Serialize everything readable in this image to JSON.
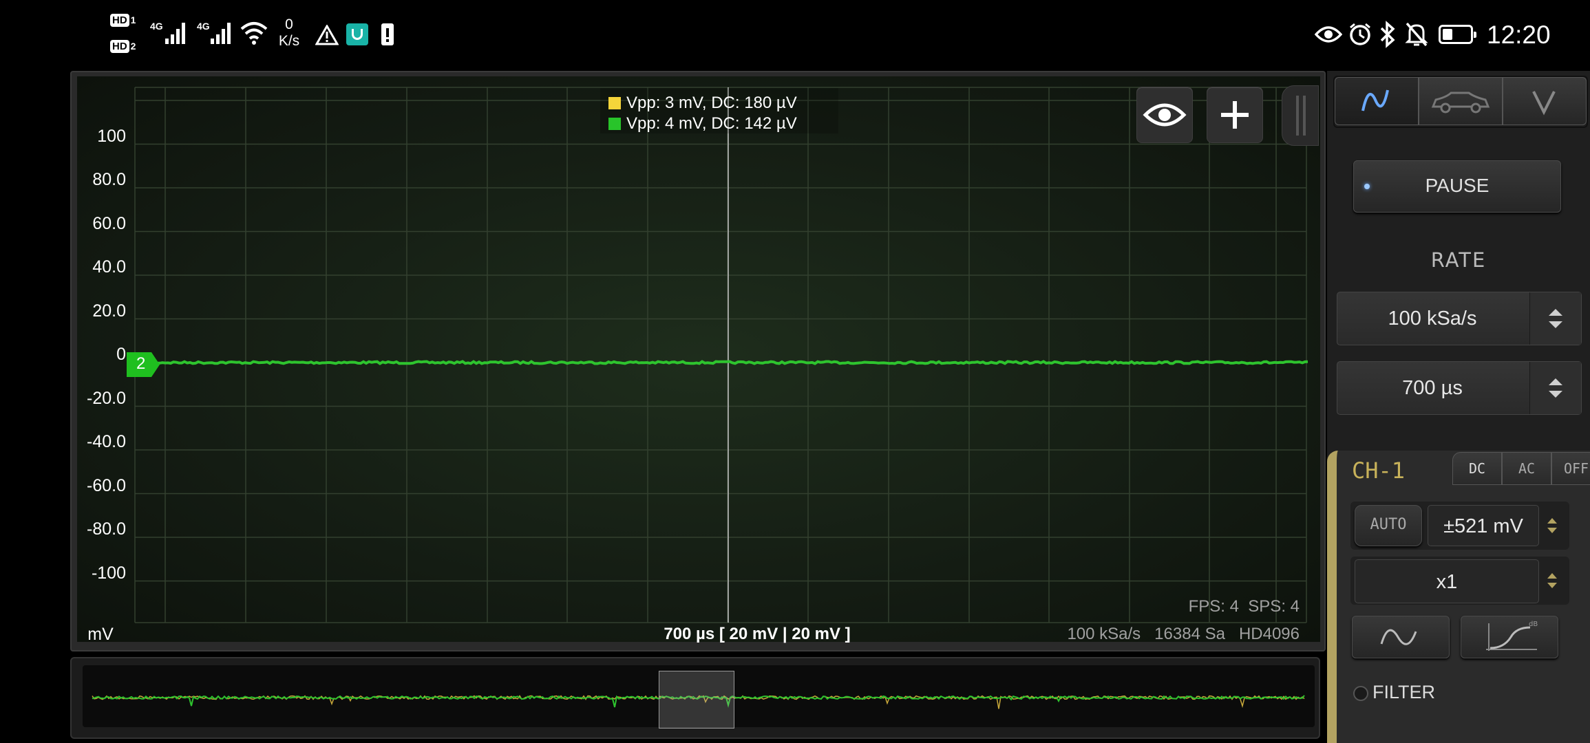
{
  "status_bar": {
    "hd1": "HD",
    "hd1_sub": "1",
    "hd2": "HD",
    "hd2_sub": "2",
    "net1": "4G",
    "net2": "4G",
    "speed_value": "0",
    "speed_unit": "K/s",
    "time": "12:20",
    "icons": [
      "signal-icon",
      "wifi-icon",
      "warning-icon",
      "mi-home-icon",
      "battery-alert-icon",
      "eye-icon",
      "alarm-icon",
      "bluetooth-icon",
      "mute-icon",
      "battery-icon"
    ]
  },
  "scope": {
    "legend": [
      {
        "text": "Vpp: 3 mV, DC: 180 µV",
        "color": "#f5d53a"
      },
      {
        "text": "Vpp: 4 mV, DC: 142 µV",
        "color": "#28c42a"
      }
    ],
    "y_ticks": [
      "100",
      "80.0",
      "60.0",
      "40.0",
      "20.0",
      "0",
      "-20.0",
      "-40.0",
      "-60.0",
      "-80.0",
      "-100"
    ],
    "y_unit": "mV",
    "channel_marker": "2",
    "fps_sps": "FPS: 4  SPS: 4",
    "timebase_info": "700 µs  [ 20 mV | 20 mV ]",
    "sample_info": "100 kSa/s   16384 Sa   HD4096",
    "toolbar": {
      "view_icon": "eye-icon",
      "add_icon": "plus-icon"
    },
    "trace_color": "#2ec42e"
  },
  "right_panel": {
    "mode_tabs": [
      {
        "icon": "sine-wave-icon",
        "active": true
      },
      {
        "icon": "car-icon",
        "active": false
      },
      {
        "icon": "voltmeter-icon",
        "label": "V",
        "active": false
      }
    ],
    "pause_label": "PAUSE",
    "rate_heading": "RATE",
    "sample_rate": "100 kSa/s",
    "time_div": "700 µs",
    "channel": {
      "name": "CH-1",
      "coupling": [
        "DC",
        "AC",
        "OFF"
      ],
      "auto_label": "AUTO",
      "range": "±521 mV",
      "probe": "x1",
      "filter_label": "FILTER",
      "accent": "#b3a361"
    }
  }
}
